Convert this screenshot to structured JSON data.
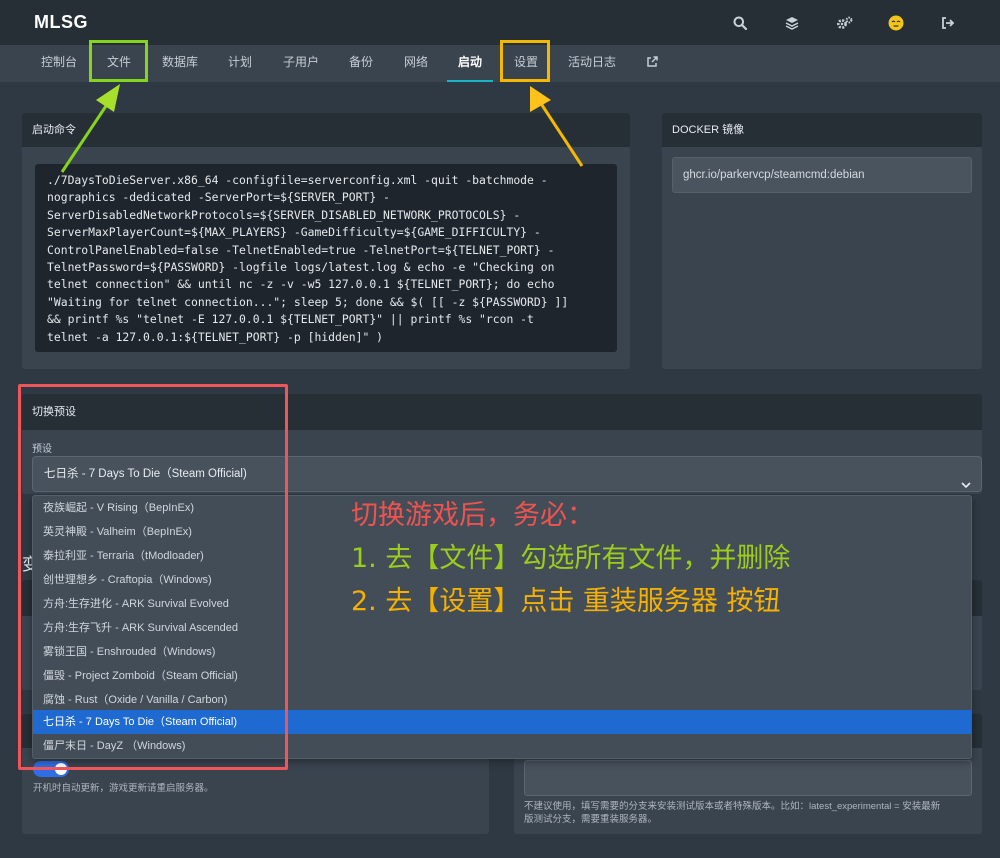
{
  "app": {
    "title": "MLSG"
  },
  "top_icons": [
    "search-icon",
    "layers-icon",
    "gears-icon",
    "avatar-emoji-icon",
    "logout-icon"
  ],
  "nav": {
    "items": [
      {
        "label": "控制台"
      },
      {
        "label": "文件"
      },
      {
        "label": "数据库"
      },
      {
        "label": "计划"
      },
      {
        "label": "子用户"
      },
      {
        "label": "备份"
      },
      {
        "label": "网络"
      },
      {
        "label": "启动"
      },
      {
        "label": "设置"
      },
      {
        "label": "活动日志"
      }
    ],
    "active": "启动",
    "external_icon": "external-link-icon"
  },
  "startup": {
    "title": "启动命令",
    "command_lines": [
      "./7DaysToDieServer.x86_64 -configfile=serverconfig.xml -quit -batchmode -",
      "nographics -dedicated -ServerPort=${SERVER_PORT} -",
      "ServerDisabledNetworkProtocols=${SERVER_DISABLED_NETWORK_PROTOCOLS} -",
      "ServerMaxPlayerCount=${MAX_PLAYERS} -GameDifficulty=${GAME_DIFFICULTY} -",
      "ControlPanelEnabled=false -TelnetEnabled=true -TelnetPort=${TELNET_PORT} -",
      "TelnetPassword=${PASSWORD} -logfile logs/latest.log & echo -e \"Checking on",
      "telnet connection\" && until nc -z -v -w5 127.0.0.1 ${TELNET_PORT}; do echo",
      "\"Waiting for telnet connection...\"; sleep 5; done && $( [[ -z ${PASSWORD} ]]",
      "&& printf %s \"telnet -E 127.0.0.1 ${TELNET_PORT}\" || printf %s \"rcon -t",
      "telnet -a 127.0.0.1:${TELNET_PORT} -p [hidden]\" )"
    ]
  },
  "docker": {
    "title": "DOCKER 镜像",
    "image": "ghcr.io/parkervcp/steamcmd:debian"
  },
  "preset": {
    "title": "切换预设",
    "label": "预设",
    "selected": "七日杀 - 7 Days To Die（Steam Official)",
    "options": [
      "夜族崛起 - V Rising（BepInEx)",
      "英灵神殿 - Valheim（BepInEx)",
      "泰拉利亚 - Terraria（tModloader)",
      "创世理想乡 - Craftopia（Windows)",
      "方舟:生存进化 - ARK Survival Evolved",
      "方舟:生存飞升 - ARK Survival Ascended",
      "雾锁王国 - Enshrouded（Windows)",
      "僵毁 - Project Zomboid（Steam Official)",
      "腐蚀 - Rust（Oxide / Vanilla / Carbon)",
      "七日杀 - 7 Days To Die（Steam Official)",
      "僵尸末日 - DayZ （Windows)"
    ],
    "selected_index": 9
  },
  "annotation": {
    "heading": "切换游戏后，务必：",
    "step1": "1. 去【文件】勾选所有文件，并删除",
    "step2": "2. 去【设置】点击 重装服务器 按钮",
    "colors": {
      "heading": "#ef5350",
      "step1": "#9ccc1c",
      "step2": "#f5b000"
    }
  },
  "hidden_card": {
    "partial_title": "变"
  },
  "auto_update": {
    "enabled": true,
    "note": "开机时自动更新，游戏更新请重启服务器。"
  },
  "branch": {
    "value": "",
    "note_line1": "不建议使用，填写需要的分支来安装测试版本或者特殊版本。比如：latest_experimental = 安装最新",
    "note_line2": "版测试分支，需要重装服务器。"
  }
}
